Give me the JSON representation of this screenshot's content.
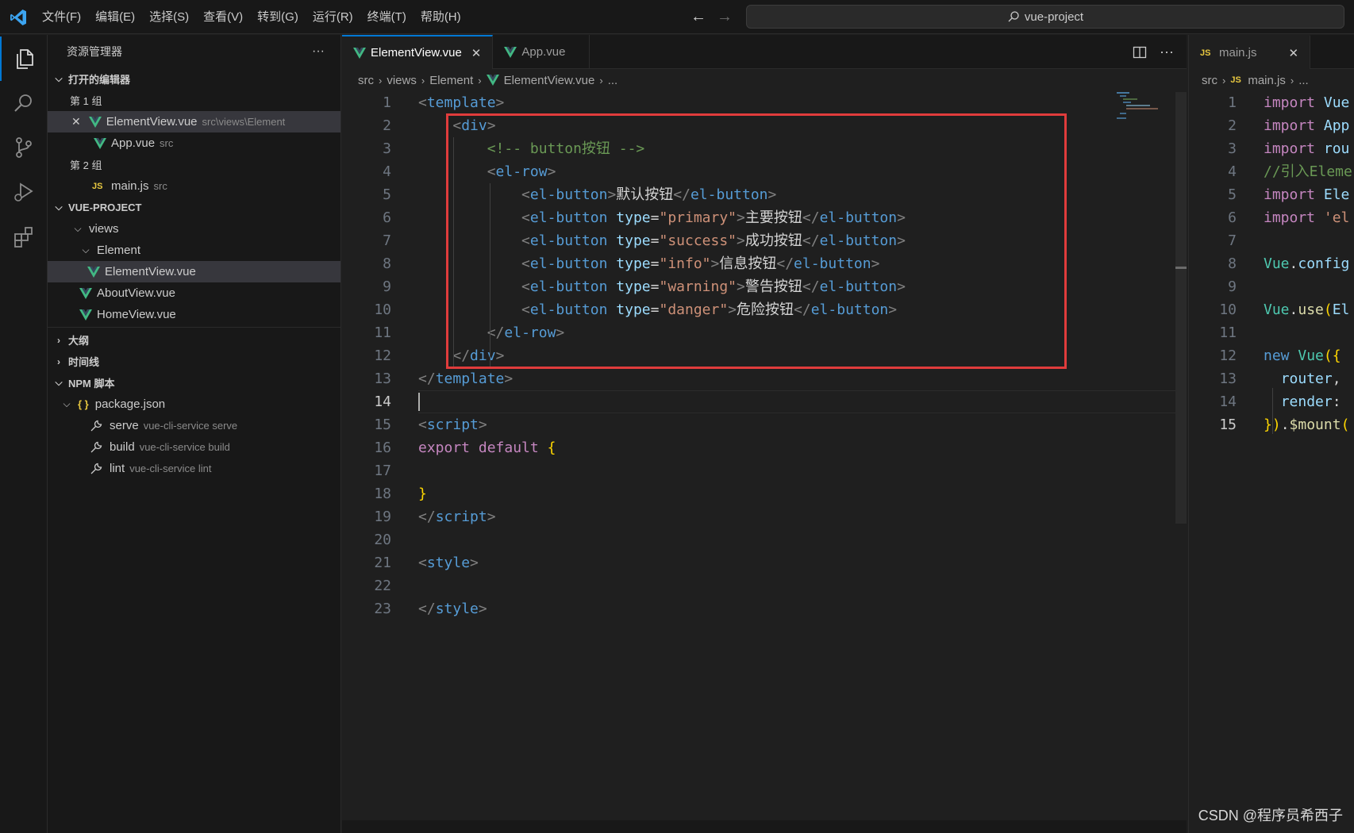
{
  "menu": [
    "文件(F)",
    "编辑(E)",
    "选择(S)",
    "查看(V)",
    "转到(G)",
    "运行(R)",
    "终端(T)",
    "帮助(H)"
  ],
  "command_center": {
    "label": "vue-project"
  },
  "sidebar": {
    "title": "资源管理器",
    "more": "···",
    "open_editors": {
      "header": "打开的编辑器",
      "group1_label": "第 1 组",
      "group1": [
        {
          "name": "ElementView.vue",
          "desc": "src\\views\\Element"
        },
        {
          "name": "App.vue",
          "desc": "src"
        }
      ],
      "group2_label": "第 2 组",
      "group2": [
        {
          "name": "main.js",
          "desc": "src",
          "icon": "JS"
        }
      ]
    },
    "project": {
      "header": "VUE-PROJECT",
      "tree": [
        {
          "name": "views"
        },
        {
          "name": "Element"
        },
        {
          "name": "ElementView.vue"
        },
        {
          "name": "AboutView.vue"
        },
        {
          "name": "HomeView.vue"
        }
      ]
    },
    "outline_header": "大纲",
    "timeline_header": "时间线",
    "npm": {
      "header": "NPM 脚本",
      "package": "package.json",
      "package_icon": "{ }",
      "scripts": [
        {
          "name": "serve",
          "cmd": "vue-cli-service serve"
        },
        {
          "name": "build",
          "cmd": "vue-cli-service build"
        },
        {
          "name": "lint",
          "cmd": "vue-cli-service lint"
        }
      ]
    }
  },
  "editor1": {
    "tabs": [
      {
        "label": "ElementView.vue",
        "close": "✕"
      },
      {
        "label": "App.vue"
      }
    ],
    "breadcrumb": [
      "src",
      "views",
      "Element",
      "ElementView.vue",
      "..."
    ],
    "current_line": 14,
    "lines": [
      {
        "n": "1",
        "code": [
          [
            "br",
            "<"
          ],
          [
            "tag",
            "template"
          ],
          [
            "br",
            ">"
          ]
        ]
      },
      {
        "n": "2",
        "code": [
          [
            "sp",
            "    "
          ],
          [
            "br",
            "<"
          ],
          [
            "tag",
            "div"
          ],
          [
            "br",
            ">"
          ]
        ]
      },
      {
        "n": "3",
        "code": [
          [
            "sp",
            "        "
          ],
          [
            "com",
            "<!-- button按钮 -->"
          ]
        ]
      },
      {
        "n": "4",
        "code": [
          [
            "sp",
            "        "
          ],
          [
            "br",
            "<"
          ],
          [
            "tag",
            "el-row"
          ],
          [
            "br",
            ">"
          ]
        ]
      },
      {
        "n": "5",
        "code": [
          [
            "sp",
            "            "
          ],
          [
            "br",
            "<"
          ],
          [
            "tag",
            "el-button"
          ],
          [
            "br",
            ">"
          ],
          [
            "txt",
            "默认按钮"
          ],
          [
            "br",
            "</"
          ],
          [
            "tag",
            "el-button"
          ],
          [
            "br",
            ">"
          ]
        ]
      },
      {
        "n": "6",
        "code": [
          [
            "sp",
            "            "
          ],
          [
            "br",
            "<"
          ],
          [
            "tag",
            "el-button"
          ],
          [
            "txt",
            " "
          ],
          [
            "attr",
            "type"
          ],
          [
            "txt",
            "="
          ],
          [
            "str",
            "\"primary\""
          ],
          [
            "br",
            ">"
          ],
          [
            "txt",
            "主要按钮"
          ],
          [
            "br",
            "</"
          ],
          [
            "tag",
            "el-button"
          ],
          [
            "br",
            ">"
          ]
        ]
      },
      {
        "n": "7",
        "code": [
          [
            "sp",
            "            "
          ],
          [
            "br",
            "<"
          ],
          [
            "tag",
            "el-button"
          ],
          [
            "txt",
            " "
          ],
          [
            "attr",
            "type"
          ],
          [
            "txt",
            "="
          ],
          [
            "str",
            "\"success\""
          ],
          [
            "br",
            ">"
          ],
          [
            "txt",
            "成功按钮"
          ],
          [
            "br",
            "</"
          ],
          [
            "tag",
            "el-button"
          ],
          [
            "br",
            ">"
          ]
        ]
      },
      {
        "n": "8",
        "code": [
          [
            "sp",
            "            "
          ],
          [
            "br",
            "<"
          ],
          [
            "tag",
            "el-button"
          ],
          [
            "txt",
            " "
          ],
          [
            "attr",
            "type"
          ],
          [
            "txt",
            "="
          ],
          [
            "str",
            "\"info\""
          ],
          [
            "br",
            ">"
          ],
          [
            "txt",
            "信息按钮"
          ],
          [
            "br",
            "</"
          ],
          [
            "tag",
            "el-button"
          ],
          [
            "br",
            ">"
          ]
        ]
      },
      {
        "n": "9",
        "code": [
          [
            "sp",
            "            "
          ],
          [
            "br",
            "<"
          ],
          [
            "tag",
            "el-button"
          ],
          [
            "txt",
            " "
          ],
          [
            "attr",
            "type"
          ],
          [
            "txt",
            "="
          ],
          [
            "str",
            "\"warning\""
          ],
          [
            "br",
            ">"
          ],
          [
            "txt",
            "警告按钮"
          ],
          [
            "br",
            "</"
          ],
          [
            "tag",
            "el-button"
          ],
          [
            "br",
            ">"
          ]
        ]
      },
      {
        "n": "10",
        "code": [
          [
            "sp",
            "            "
          ],
          [
            "br",
            "<"
          ],
          [
            "tag",
            "el-button"
          ],
          [
            "txt",
            " "
          ],
          [
            "attr",
            "type"
          ],
          [
            "txt",
            "="
          ],
          [
            "str",
            "\"danger\""
          ],
          [
            "br",
            ">"
          ],
          [
            "txt",
            "危险按钮"
          ],
          [
            "br",
            "</"
          ],
          [
            "tag",
            "el-button"
          ],
          [
            "br",
            ">"
          ]
        ]
      },
      {
        "n": "11",
        "code": [
          [
            "sp",
            "        "
          ],
          [
            "br",
            "</"
          ],
          [
            "tag",
            "el-row"
          ],
          [
            "br",
            ">"
          ]
        ]
      },
      {
        "n": "12",
        "code": [
          [
            "sp",
            "    "
          ],
          [
            "br",
            "</"
          ],
          [
            "tag",
            "div"
          ],
          [
            "br",
            ">"
          ]
        ]
      },
      {
        "n": "13",
        "code": [
          [
            "br",
            "</"
          ],
          [
            "tag",
            "template"
          ],
          [
            "br",
            ">"
          ]
        ]
      },
      {
        "n": "14",
        "code": []
      },
      {
        "n": "15",
        "code": [
          [
            "br",
            "<"
          ],
          [
            "tag",
            "script"
          ],
          [
            "br",
            ">"
          ]
        ]
      },
      {
        "n": "16",
        "code": [
          [
            "kw",
            "export"
          ],
          [
            "txt",
            " "
          ],
          [
            "kw",
            "default"
          ],
          [
            "txt",
            " "
          ],
          [
            "br1",
            "{"
          ]
        ]
      },
      {
        "n": "17",
        "code": []
      },
      {
        "n": "18",
        "code": [
          [
            "br1",
            "}"
          ]
        ]
      },
      {
        "n": "19",
        "code": [
          [
            "br",
            "</"
          ],
          [
            "tag",
            "script"
          ],
          [
            "br",
            ">"
          ]
        ]
      },
      {
        "n": "20",
        "code": []
      },
      {
        "n": "21",
        "code": [
          [
            "br",
            "<"
          ],
          [
            "tag",
            "style"
          ],
          [
            "br",
            ">"
          ]
        ]
      },
      {
        "n": "22",
        "code": []
      },
      {
        "n": "23",
        "code": [
          [
            "br",
            "</"
          ],
          [
            "tag",
            "style"
          ],
          [
            "br",
            ">"
          ]
        ]
      }
    ]
  },
  "editor2": {
    "tabs": [
      {
        "label": "main.js",
        "icon": "JS",
        "close": "✕"
      }
    ],
    "breadcrumb": [
      "src",
      "main.js",
      "..."
    ],
    "current_line": 15,
    "lines": [
      {
        "n": "1",
        "code": [
          [
            "kw",
            "import"
          ],
          [
            "txt",
            " "
          ],
          [
            "var",
            "Vue"
          ]
        ]
      },
      {
        "n": "2",
        "code": [
          [
            "kw",
            "import"
          ],
          [
            "txt",
            " "
          ],
          [
            "var",
            "App"
          ]
        ]
      },
      {
        "n": "3",
        "code": [
          [
            "kw",
            "import"
          ],
          [
            "txt",
            " "
          ],
          [
            "var",
            "rou"
          ]
        ]
      },
      {
        "n": "4",
        "code": [
          [
            "com",
            "//引入Eleme"
          ]
        ]
      },
      {
        "n": "5",
        "code": [
          [
            "kw",
            "import"
          ],
          [
            "txt",
            " "
          ],
          [
            "var",
            "Ele"
          ]
        ]
      },
      {
        "n": "6",
        "code": [
          [
            "kw",
            "import"
          ],
          [
            "txt",
            " "
          ],
          [
            "str",
            "'el"
          ]
        ]
      },
      {
        "n": "7",
        "code": []
      },
      {
        "n": "8",
        "code": [
          [
            "cls",
            "Vue"
          ],
          [
            "txt",
            "."
          ],
          [
            "var",
            "config"
          ]
        ]
      },
      {
        "n": "9",
        "code": []
      },
      {
        "n": "10",
        "code": [
          [
            "cls",
            "Vue"
          ],
          [
            "txt",
            "."
          ],
          [
            "fn",
            "use"
          ],
          [
            "br1",
            "("
          ],
          [
            "var",
            "El"
          ]
        ]
      },
      {
        "n": "11",
        "code": []
      },
      {
        "n": "12",
        "code": [
          [
            "blue",
            "new"
          ],
          [
            "txt",
            " "
          ],
          [
            "cls",
            "Vue"
          ],
          [
            "br1",
            "({"
          ]
        ]
      },
      {
        "n": "13",
        "code": [
          [
            "sp",
            "  "
          ],
          [
            "var",
            "router"
          ],
          [
            "txt",
            ","
          ]
        ]
      },
      {
        "n": "14",
        "code": [
          [
            "sp",
            "  "
          ],
          [
            "var",
            "render"
          ],
          [
            "txt",
            ":"
          ]
        ]
      },
      {
        "n": "15",
        "code": [
          [
            "br1",
            "})"
          ],
          [
            "txt",
            "."
          ],
          [
            "fn",
            "$mount"
          ],
          [
            "br1",
            "("
          ]
        ]
      }
    ]
  },
  "watermark": "CSDN @程序员希西子",
  "colors": {
    "accent": "#0078d4",
    "highlight_box": "#e03c3c",
    "vue_green": "#42b883",
    "js_yellow": "#e8c840"
  }
}
